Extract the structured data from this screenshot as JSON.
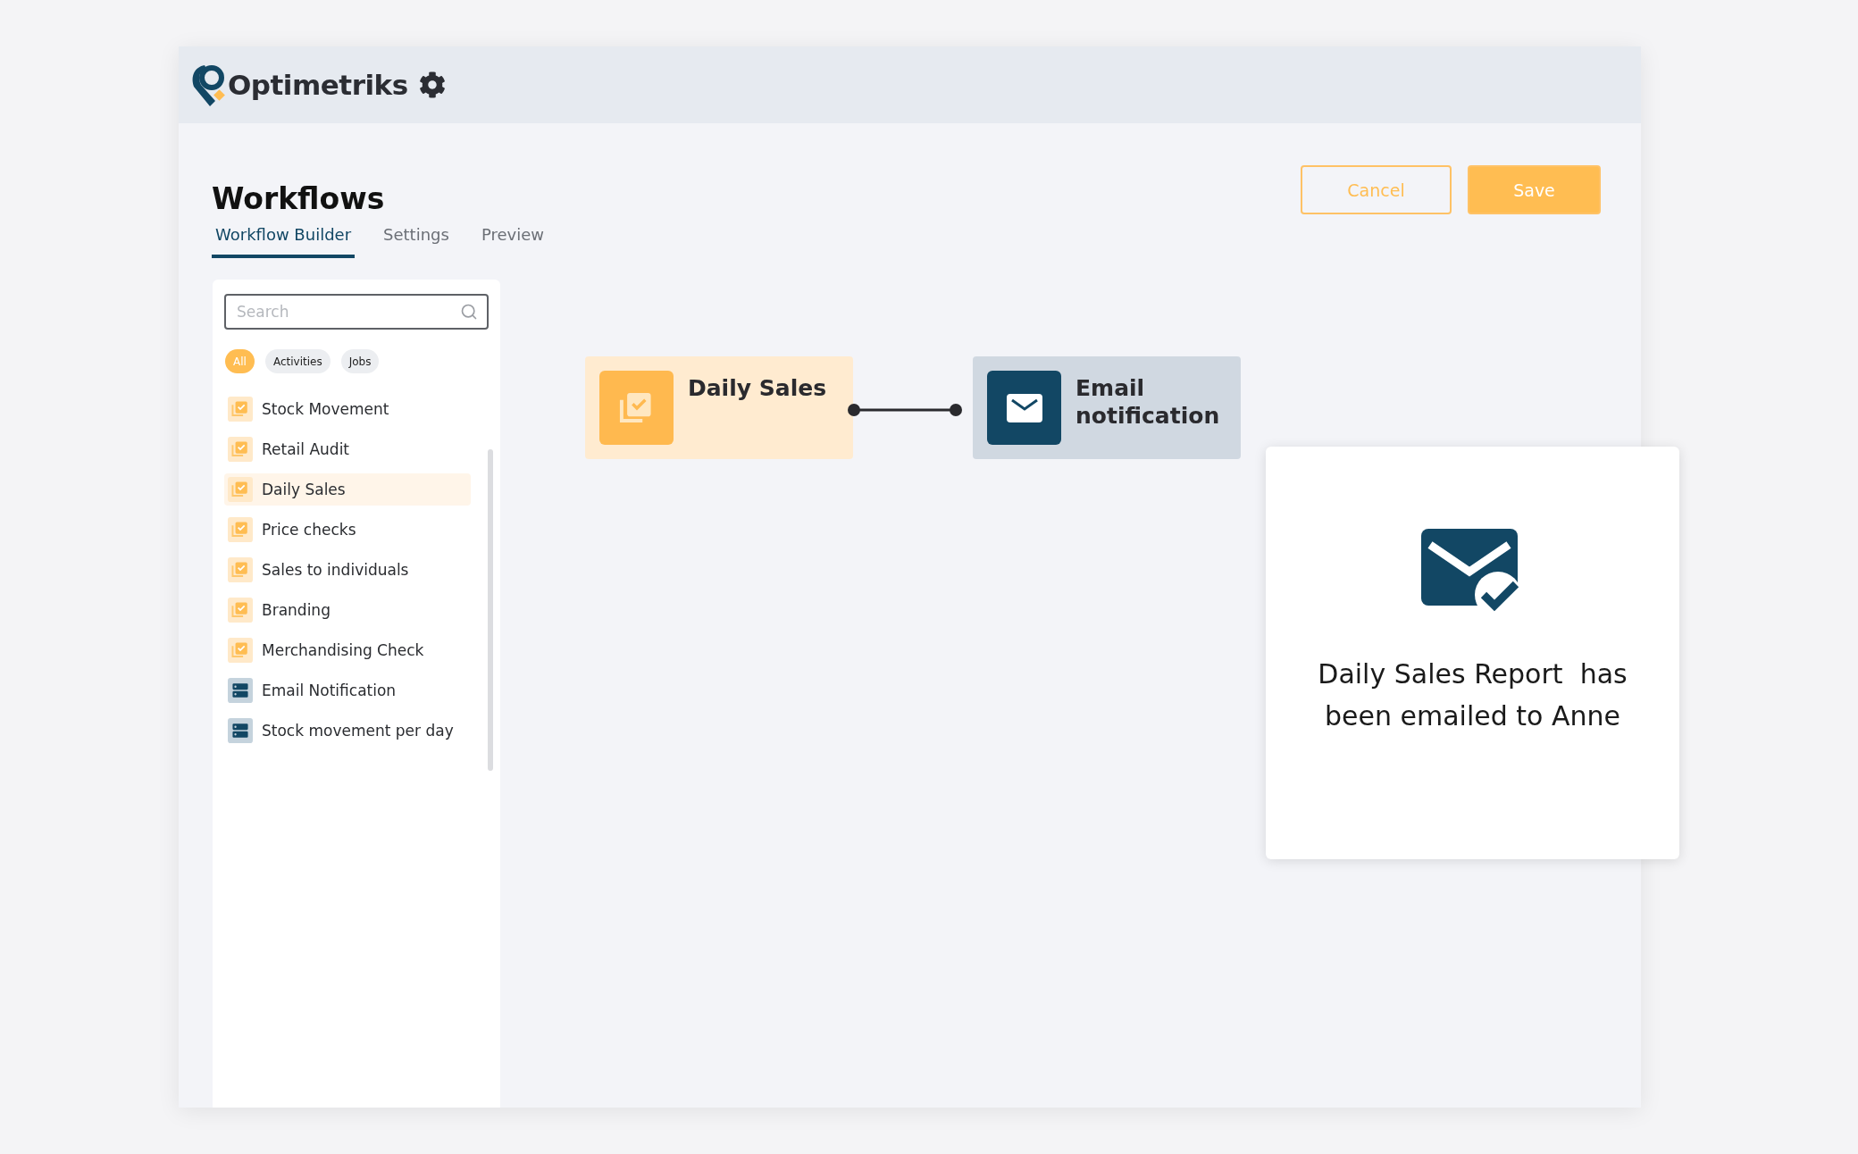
{
  "app": {
    "logo_text": "Optimetriks"
  },
  "page": {
    "title": "Workflows"
  },
  "tabs": [
    {
      "label": "Workflow Builder",
      "selected": true
    },
    {
      "label": "Settings",
      "selected": false
    },
    {
      "label": "Preview",
      "selected": false
    }
  ],
  "buttons": [
    {
      "label": "Cancel",
      "kind": "secondary"
    },
    {
      "label": "Save",
      "kind": "primary"
    }
  ],
  "sidebar": {
    "search": {
      "placeholder": "Search"
    },
    "filters": [
      {
        "label": "All",
        "selected": true
      },
      {
        "label": "Activities",
        "selected": false
      },
      {
        "label": "Jobs",
        "selected": false
      }
    ],
    "items": [
      {
        "label": "Stock Movement",
        "kind": "activity",
        "selected": false
      },
      {
        "label": "Retail Audit",
        "kind": "activity",
        "selected": false
      },
      {
        "label": "Daily Sales",
        "kind": "activity",
        "selected": true
      },
      {
        "label": "Price checks",
        "kind": "activity",
        "selected": false
      },
      {
        "label": "Sales to individuals",
        "kind": "activity",
        "selected": false
      },
      {
        "label": "Branding",
        "kind": "activity",
        "selected": false
      },
      {
        "label": "Merchandising Check",
        "kind": "activity",
        "selected": false
      },
      {
        "label": "Email Notification",
        "kind": "job",
        "selected": false
      },
      {
        "label": "Stock movement per day",
        "kind": "job",
        "selected": false
      }
    ]
  },
  "canvas": {
    "nodes": [
      {
        "label": "Daily Sales",
        "kind": "activity"
      },
      {
        "label": "Email notification",
        "kind": "email"
      }
    ]
  },
  "notification": {
    "message": "Daily Sales Report  has been emailed to Anne"
  }
}
